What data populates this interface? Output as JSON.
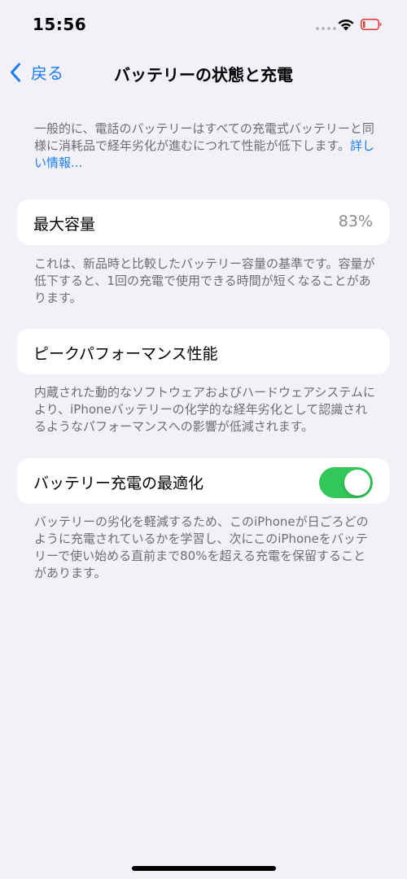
{
  "status_bar": {
    "time": "15:56",
    "battery_color": "#e0362e",
    "battery_level_fraction": 0.1
  },
  "nav": {
    "back_label": "戻る",
    "title": "バッテリーの状態と充電"
  },
  "intro": {
    "text": "一般的に、電話のバッテリーはすべての充電式バッテリーと同様に消耗品で経年劣化が進むにつれて性能が低下します。",
    "link": "詳しい情報..."
  },
  "max_capacity": {
    "label": "最大容量",
    "value": "83%",
    "description": "これは、新品時と比較したバッテリー容量の基準です。容量が低下すると、1回の充電で使用できる時間が短くなることがあります。"
  },
  "peak_performance": {
    "label": "ピークパフォーマンス性能",
    "description": "内蔵された動的なソフトウェアおよびハードウェアシステムにより、iPhoneバッテリーの化学的な経年劣化として認識されるようなパフォーマンスへの影響が低減されます。"
  },
  "optimized_charging": {
    "label": "バッテリー充電の最適化",
    "enabled": true,
    "toggle_color": "#33c759",
    "description": "バッテリーの劣化を軽減するため、このiPhoneが日ごろどのように充電されているかを学習し、次にこのiPhoneをバッテリーで使い始める直前まで80%を超える充電を保留することがあります。"
  }
}
